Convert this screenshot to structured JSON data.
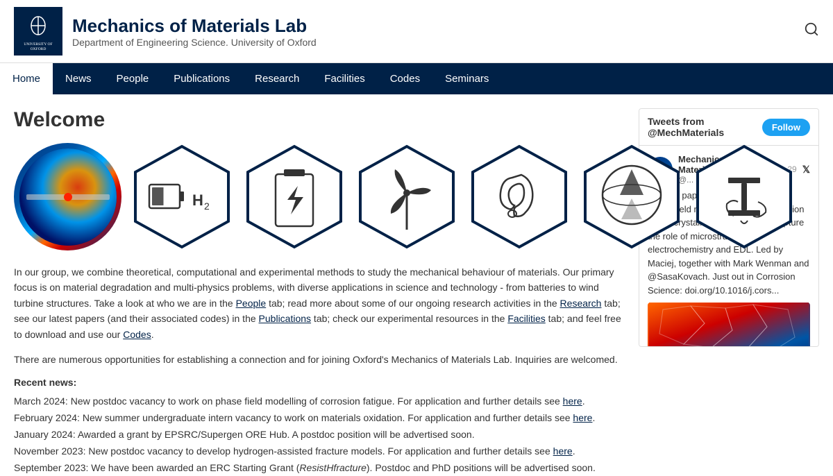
{
  "header": {
    "logo_text": "UNIVERSITY OF OXFORD",
    "site_title": "Mechanics of Materials Lab",
    "site_subtitle": "Department of Engineering Science. University of Oxford"
  },
  "nav": {
    "items": [
      {
        "label": "Home",
        "active": true
      },
      {
        "label": "News",
        "active": false
      },
      {
        "label": "People",
        "active": false
      },
      {
        "label": "Publications",
        "active": false
      },
      {
        "label": "Research",
        "active": false
      },
      {
        "label": "Facilities",
        "active": false
      },
      {
        "label": "Codes",
        "active": false
      },
      {
        "label": "Seminars",
        "active": false
      }
    ]
  },
  "main": {
    "welcome_title": "Welcome",
    "description1": "In our group, we combine theoretical, computational and experimental methods to study the mechanical behaviour of materials. Our primary focus is on material degradation and multi-physics problems, with diverse applications in science and technology - from batteries to wind turbine structures. Take a look at who we are in the ",
    "desc_link1": "People",
    "description2": " tab; read more about some of our ongoing research activities in the ",
    "desc_link2": "Research",
    "description3": " tab; see our latest papers (and their associated codes) in the ",
    "desc_link3": "Publications",
    "description4": " tab; check our experimental resources in the ",
    "desc_link4": "Facilities",
    "description5": " tab; and feel free to download and use our ",
    "desc_link5": "Codes",
    "description6": ".",
    "description_line2": "There are numerous opportunities for establishing a connection and for joining Oxford's Mechanics of Materials Lab. Inquiries are welcomed.",
    "news_title": "Recent news:",
    "news_items": [
      {
        "text": "March 2024: New postdoc vacancy to work on phase field modelling of corrosion fatigue. For application and further details see ",
        "link": "here",
        "suffix": "."
      },
      {
        "text": "February 2024: New summer undergraduate intern vacancy to work on materials oxidation. For application and further details see ",
        "link": "here",
        "suffix": "."
      },
      {
        "text": "January 2024: Awarded a grant by EPSRC/Supergen ORE Hub. A postdoc position will be advertised soon.",
        "link": "",
        "suffix": ""
      },
      {
        "text": "November 2023: New postdoc vacancy to develop hydrogen-assisted fracture models. For application and further details see ",
        "link": "here",
        "suffix": "."
      },
      {
        "text": "September 2023: We have been awarded an ERC Starting Grant (",
        "link": "ResistHfracture",
        "link_italic": true,
        "suffix": "). Postdoc and PhD positions will be advertised soon."
      }
    ]
  },
  "twitter": {
    "header": "Tweets from @MechMaterials",
    "follow_label": "Follow",
    "tweet_name": "Mechanics of Materi...",
    "tweet_handle": "@...",
    "tweet_date": "Apr 29",
    "tweet_body": "🚨 New paper! We develop a new phase field model to simulate corrosion in polycrystalline materials. We capture the role of microstructure, electrochemistry and EDL. Led by Maciej, together with Mark Wenman and @SasaKovach. Just out in Corrosion Science: doi.org/10.1016/j.cors..."
  }
}
